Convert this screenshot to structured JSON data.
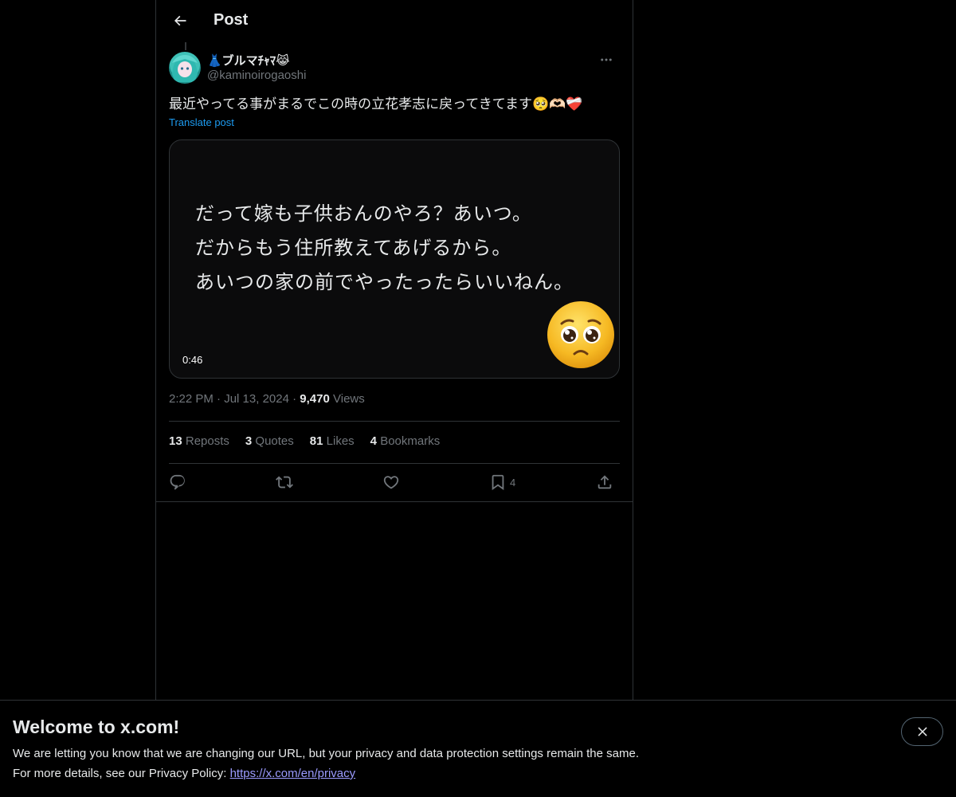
{
  "header": {
    "back_icon": "arrow-left-icon",
    "title": "Post"
  },
  "post": {
    "author": {
      "display_name": "👗ブルマﾁｬﾏ😹",
      "handle": "@kaminoirogaoshi",
      "avatar_icon": "avatar-image"
    },
    "more_icon": "ellipsis-icon",
    "text": "最近やってる事がまるでこの時の立花孝志に戻ってきてます🥺🫶🏻❤️‍🩹",
    "translate_label": "Translate post",
    "media": {
      "lines": [
        "だって嫁も子供おんのやろ？あいつ。",
        "だからもう住所教えてあげるから。",
        "あいつの家の前でやったったらいいねん。"
      ],
      "emoji_icon": "pleading-face-icon",
      "duration": "0:46"
    },
    "time": "2:22 PM",
    "dot": "·",
    "date": "Jul 13, 2024",
    "views_count": "9,470",
    "views_label": "Views",
    "stats": {
      "reposts_count": "13",
      "reposts_label": "Reposts",
      "quotes_count": "3",
      "quotes_label": "Quotes",
      "likes_count": "81",
      "likes_label": "Likes",
      "bookmarks_count": "4",
      "bookmarks_label": "Bookmarks"
    },
    "actions": {
      "reply_icon": "reply-icon",
      "repost_icon": "repost-icon",
      "like_icon": "heart-icon",
      "bookmark_icon": "bookmark-icon",
      "bookmark_count": "4",
      "share_icon": "share-icon"
    }
  },
  "banner": {
    "title": "Welcome to x.com!",
    "line1": "We are letting you know that we are changing our URL, but your privacy and data protection settings remain the same.",
    "line2_prefix": "For more details, see our Privacy Policy: ",
    "link": "https://x.com/en/privacy",
    "close_icon": "close-icon"
  },
  "colors": {
    "background": "#000000",
    "text": "#e7e9ea",
    "secondary_text": "#71767b",
    "accent": "#1d9bf0",
    "border": "#2f3336"
  }
}
